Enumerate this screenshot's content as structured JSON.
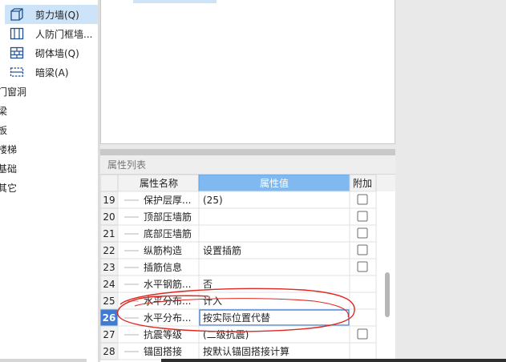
{
  "tree": {
    "sub_items": [
      {
        "label": "剪力墙(Q)",
        "icon": "shear-wall-icon",
        "selected": true
      },
      {
        "label": "人防门框墙...",
        "icon": "civil-defense-door-frame-wall-icon",
        "selected": false
      },
      {
        "label": "砌体墙(Q)",
        "icon": "masonry-wall-icon",
        "selected": false
      },
      {
        "label": "暗梁(A)",
        "icon": "hidden-beam-icon",
        "selected": false
      }
    ],
    "top_items": [
      {
        "label": "门窗洞"
      },
      {
        "label": "梁"
      },
      {
        "label": "板"
      },
      {
        "label": "楼梯"
      },
      {
        "label": "基础"
      },
      {
        "label": "其它"
      }
    ]
  },
  "properties": {
    "panel_title": "属性列表",
    "columns": {
      "name": "属性名称",
      "value": "属性值",
      "extra": "附加"
    },
    "rows": [
      {
        "num": "19",
        "name": "保护层厚...",
        "value": "(25)",
        "has_checkbox": true,
        "selected": false
      },
      {
        "num": "20",
        "name": "顶部压墙筋",
        "value": "",
        "has_checkbox": true,
        "selected": false
      },
      {
        "num": "21",
        "name": "底部压墙筋",
        "value": "",
        "has_checkbox": true,
        "selected": false
      },
      {
        "num": "22",
        "name": "纵筋构造",
        "value": "设置插筋",
        "has_checkbox": true,
        "selected": false
      },
      {
        "num": "23",
        "name": "插筋信息",
        "value": "",
        "has_checkbox": true,
        "selected": false
      },
      {
        "num": "24",
        "name": "水平钢筋...",
        "value": "否",
        "has_checkbox": false,
        "selected": false
      },
      {
        "num": "25",
        "name": "水平分布...",
        "value": "计入",
        "has_checkbox": false,
        "selected": false
      },
      {
        "num": "26",
        "name": "水平分布...",
        "value": "按实际位置代替",
        "has_checkbox": false,
        "selected": true
      },
      {
        "num": "27",
        "name": "抗震等级",
        "value": "(二级抗震)",
        "has_checkbox": true,
        "selected": false
      },
      {
        "num": "28",
        "name": "锚固搭接",
        "value": "按默认锚固搭接计算",
        "has_checkbox": false,
        "selected": false
      }
    ]
  },
  "colors": {
    "selection": "#cde3f7",
    "header_value_bg": "#7fb9f0",
    "row_num_selected_bg": "#3e7bd6",
    "annotation_red": "#e0261f"
  }
}
